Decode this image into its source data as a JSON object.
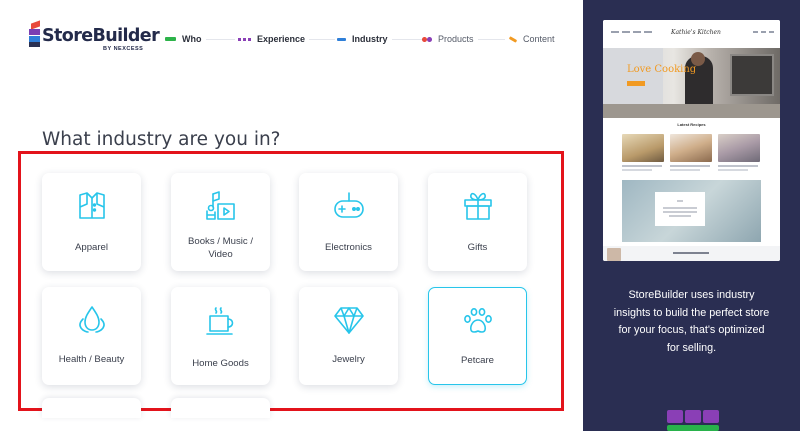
{
  "brand": {
    "name": "StoreBuilder",
    "byline": "BY NEXCESS"
  },
  "steps": [
    {
      "label": "Who",
      "state": "done",
      "color": "#2db34a"
    },
    {
      "label": "Experience",
      "state": "done",
      "color": "#8a3fb6"
    },
    {
      "label": "Industry",
      "state": "current",
      "color": "#2f7fd8"
    },
    {
      "label": "Products",
      "state": "future",
      "color": "#e84a3c"
    },
    {
      "label": "Content",
      "state": "future",
      "color": "#f19a22"
    }
  ],
  "question": "What industry are you in?",
  "industries": [
    {
      "label": "Apparel",
      "icon": "shirt-icon",
      "selected": false
    },
    {
      "label": "Books / Music / Video",
      "icon": "books-music-video-icon",
      "selected": false
    },
    {
      "label": "Electronics",
      "icon": "gamepad-icon",
      "selected": false
    },
    {
      "label": "Gifts",
      "icon": "gift-icon",
      "selected": false
    },
    {
      "label": "Health / Beauty",
      "icon": "droplet-icon",
      "selected": false
    },
    {
      "label": "Home Goods",
      "icon": "mug-icon",
      "selected": false
    },
    {
      "label": "Jewelry",
      "icon": "diamond-icon",
      "selected": false
    },
    {
      "label": "Petcare",
      "icon": "paw-icon",
      "selected": true
    }
  ],
  "colors": {
    "accent": "#27c5ea",
    "highlight": "#e3131b",
    "panel": "#2a2e52"
  },
  "preview": {
    "hero_text": "Love Cooking",
    "section_title": "Latest Recipes"
  },
  "panel_caption": "StoreBuilder uses industry insights to build the perfect store for your focus, that's optimized for selling."
}
